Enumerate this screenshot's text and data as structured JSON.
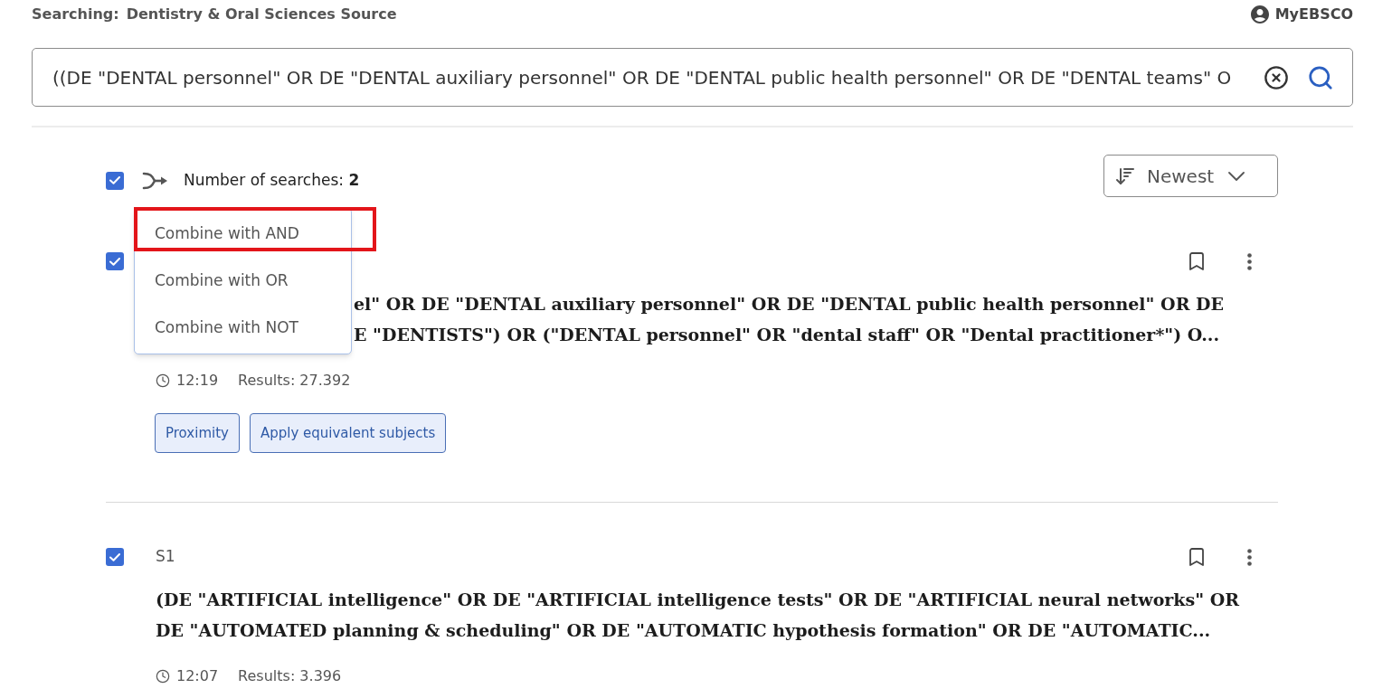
{
  "header": {
    "searching_label": "Searching:",
    "database": "Dentistry & Oral Sciences Source",
    "account_link": "MyEBSCO"
  },
  "search": {
    "value": "((DE \"DENTAL personnel\" OR DE \"DENTAL auxiliary personnel\" OR DE \"DENTAL public health personnel\" OR DE \"DENTAL teams\" O"
  },
  "toolbar": {
    "select_all_checked": true,
    "count_text": "Number of searches: **2**",
    "sort": "Newest"
  },
  "combine_menu": {
    "items": [
      {
        "label": "Combine with AND",
        "highlighted": true
      },
      {
        "label": "Combine with OR",
        "highlighted": false
      },
      {
        "label": "Combine with NOT",
        "highlighted": false
      }
    ]
  },
  "searches": [
    {
      "checked": true,
      "obscured_by_menu": true,
      "title_lines": [
        "el\" OR DE \"DENTAL auxiliary personnel\" OR DE \"DENTAL public health personnel\" OR DE",
        "E \"DENTISTS\") OR (\"DENTAL personnel\" OR \"dental staff\" OR \"Dental practitioner*\") O..."
      ],
      "time": "12:19",
      "results": "Results: 27.392",
      "tags": [
        "Proximity",
        "Apply equivalent subjects"
      ]
    },
    {
      "checked": true,
      "obscured_by_menu": false,
      "label": "S1",
      "title_lines": [
        "(DE \"ARTIFICIAL intelligence\" OR DE \"ARTIFICIAL intelligence tests\" OR DE \"ARTIFICIAL neural networks\" OR",
        "DE \"AUTOMATED planning & scheduling\" OR DE \"AUTOMATIC hypothesis formation\" OR DE \"AUTOMATIC..."
      ],
      "time": "12:07",
      "results": "Results: 3.396"
    }
  ]
}
